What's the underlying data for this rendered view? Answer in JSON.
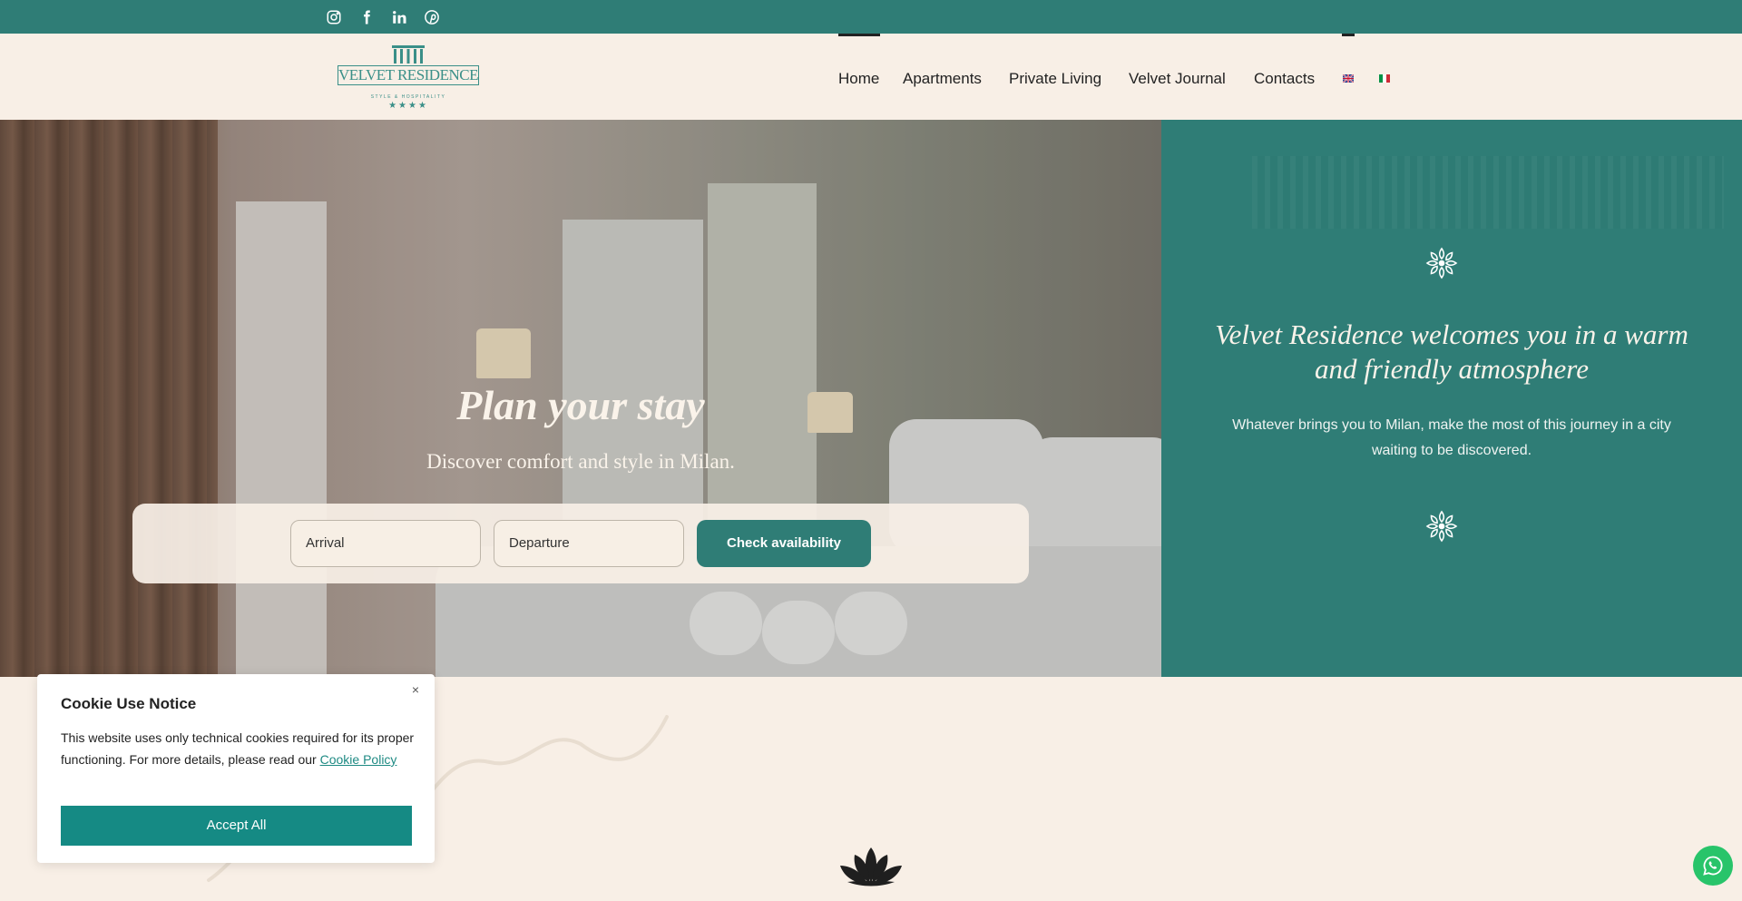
{
  "colors": {
    "teal": "#2f7d76",
    "cream": "#f8efe6",
    "button": "#158a84",
    "whatsapp": "#28c46a"
  },
  "topbar": {
    "social_icons": [
      "instagram-icon",
      "facebook-icon",
      "linkedin-icon",
      "pinterest-icon"
    ]
  },
  "logo": {
    "name": "VELVET RESIDENCE",
    "tagline": "STYLE & HOSPITALITY",
    "stars": "★★★★"
  },
  "nav": {
    "items": [
      "Home",
      "Apartments",
      "Private Living",
      "Velvet Journal",
      "Contacts"
    ],
    "active": "Home",
    "languages": [
      "english-flag-icon",
      "italian-flag-icon"
    ]
  },
  "hero": {
    "title": "Plan your stay",
    "subtitle": "Discover comfort and style in Milan.",
    "arrival_label": "Arrival",
    "departure_label": "Departure",
    "check_label": "Check availability"
  },
  "panel": {
    "title": "Velvet Residence welcomes you in a warm and friendly atmosphere",
    "text": "Whatever brings you to Milan, make the most of this journey in a city waiting to be discovered."
  },
  "cookie": {
    "title": "Cookie Use Notice",
    "text": "This website uses only technical cookies required for its proper functioning. For more details, please read our",
    "link": "Cookie Policy",
    "accept": "Accept All",
    "close": "×"
  }
}
